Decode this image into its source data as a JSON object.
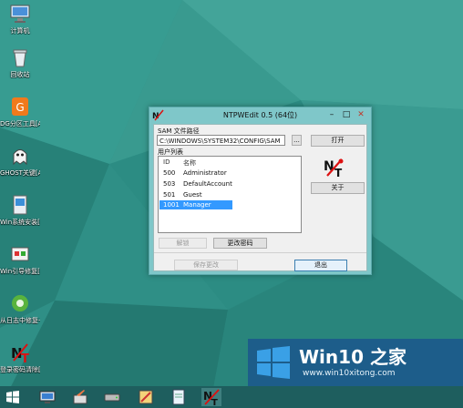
{
  "desktop": {
    "icons": [
      {
        "label": "计算机",
        "icon": "computer-icon"
      },
      {
        "label": "回收站",
        "icon": "recycle-bin-icon"
      },
      {
        "label": "DG分区工具[Alt+D]",
        "icon": "disk-partition-icon"
      },
      {
        "label": "GHOST关键[Alt+G]",
        "icon": "ghost-icon"
      },
      {
        "label": "Win系统安装[Alt+W]",
        "icon": "windows-setup-icon"
      },
      {
        "label": "Win引导修复[Alt+F]",
        "icon": "boot-repair-icon"
      },
      {
        "label": "从日志中修复一键[Alt+U]",
        "icon": "repair-icon"
      },
      {
        "label": "登录密码清除[Alt+N]",
        "icon": "password-reset-icon"
      }
    ]
  },
  "dialog": {
    "title": "NTPWEdit 0.5 (64位)",
    "controls": {
      "minimize": "–",
      "maximize": "□",
      "close": "✕"
    },
    "sam_label": "SAM 文件路径",
    "sam_path": "C:\\WINDOWS\\SYSTEM32\\CONFIG\\SAM",
    "browse_label": "...",
    "open_label": "打开",
    "userlist_label": "用户列表",
    "columns": {
      "id": "ID",
      "name": "名称"
    },
    "users": [
      {
        "id": "500",
        "name": "Administrator",
        "selected": false
      },
      {
        "id": "503",
        "name": "DefaultAccount",
        "selected": false
      },
      {
        "id": "501",
        "name": "Guest",
        "selected": false
      },
      {
        "id": "1001",
        "name": "Manager",
        "selected": true
      }
    ],
    "about_label": "关于",
    "unlock_label": "解锁",
    "change_password_label": "更改密码",
    "save_label": "保存更改",
    "exit_label": "退出"
  },
  "watermark": {
    "title_prefix": "Win10",
    "title_suffix": " 之家",
    "url": "www.win10xitong.com"
  },
  "taskbar": {
    "items": [
      "start-icon",
      "monitor-icon",
      "paint-icon",
      "drive-icon",
      "tools-icon",
      "notepad-icon",
      "ntpwedit-icon"
    ]
  },
  "colors": {
    "desktop": "#2f8f86",
    "dialog_frame": "#7fc7c9",
    "selection": "#3399ff",
    "watermark_bg": "#1d5d8a",
    "windows_logo": "#3aa0e6"
  }
}
